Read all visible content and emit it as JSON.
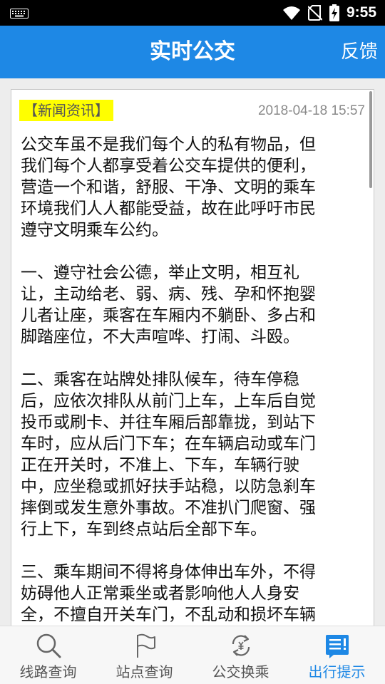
{
  "status_bar": {
    "time": "9:55",
    "icons": [
      "keyboard-icon",
      "wifi-icon",
      "no-sim-icon",
      "battery-charging-icon"
    ]
  },
  "header": {
    "title": "实时公交",
    "feedback_label": "反馈",
    "background_color": "#1e88e5"
  },
  "news": {
    "tag": "【新闻资讯】",
    "tag_color": "#ffff00",
    "date": "2018-04-18 15:57",
    "paragraphs": [
      [
        "公交车虽不是我们每个人的私有物品，但",
        "我们每个人都享受着公交车提供的便利，",
        "营造一个和谐，舒服、干净、文明的乘车",
        "环境我们人人都能受益，故在此呼吁市民",
        "遵守文明乘车公约。"
      ],
      [
        "一、遵守社会公德，举止文明，相互礼",
        "让，主动给老、弱、病、残、孕和怀抱婴",
        "儿者让座，乘客在车厢内不躺卧、多占和",
        "脚踏座位，不大声喧哗、打闹、斗殴。"
      ],
      [
        "二、乘客在站牌处排队候车，待车停稳",
        "后，应依次排队从前门上车，上车后自觉",
        "投币或刷卡、并往车厢后部靠拢，到站下",
        "车时，应从后门下车；在车辆启动或车门",
        "正在开关时，不准上、下车，车辆行驶",
        "中，应坐稳或抓好扶手站稳，以防急刹车",
        "摔倒或发生意外事故。不准扒门爬窗、强",
        "行上下，车到终点站后全部下车。"
      ],
      [
        "三、乘车期间不得将身体伸出车外，不得",
        "妨碍他人正常乘坐或者影响他人人身安",
        "全，不擅自开关车门，不乱动和损坏车辆"
      ]
    ]
  },
  "bottom_nav": {
    "active_color": "#1e88e5",
    "items": [
      {
        "label": "线路查询",
        "icon": "search-icon",
        "active": false
      },
      {
        "label": "站点查询",
        "icon": "flag-icon",
        "active": false
      },
      {
        "label": "公交换乘",
        "icon": "transfer-icon",
        "active": false
      },
      {
        "label": "出行提示",
        "icon": "notice-icon",
        "active": true
      }
    ]
  }
}
